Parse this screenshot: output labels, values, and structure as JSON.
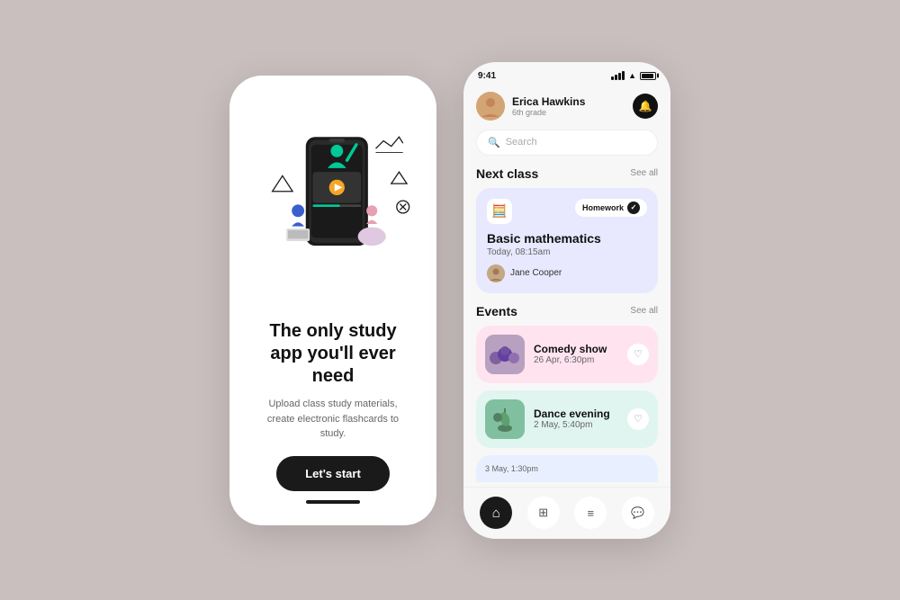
{
  "background_color": "#c9bfbe",
  "left_phone": {
    "heading": "The only study app you'll  ever need",
    "subtext": "Upload class study materials, create electronic flashcards to study.",
    "cta_label": "Let's start",
    "home_indicator": true
  },
  "right_phone": {
    "status_bar": {
      "time": "9:41"
    },
    "user": {
      "name": "Erica Hawkins",
      "grade": "6th grade"
    },
    "search_placeholder": "Search",
    "next_class": {
      "section_title": "Next class",
      "see_all": "See all",
      "card": {
        "homework_label": "Homework",
        "class_name": "Basic mathematics",
        "class_time": "Today, 08:15am",
        "teacher": "Jane Cooper"
      }
    },
    "events": {
      "section_title": "Events",
      "see_all": "See all",
      "items": [
        {
          "name": "Comedy show",
          "date": "26 Apr, 6:30pm",
          "bg": "#ffe4f0"
        },
        {
          "name": "Dance evening",
          "date": "2 May, 5:40pm",
          "bg": "#e0f5f0"
        }
      ]
    },
    "nav": {
      "items": [
        {
          "icon": "🏠",
          "active": true,
          "label": "home"
        },
        {
          "icon": "⊞",
          "active": false,
          "label": "grid"
        },
        {
          "icon": "☰",
          "active": false,
          "label": "menu"
        },
        {
          "icon": "💬",
          "active": false,
          "label": "chat"
        }
      ]
    }
  }
}
